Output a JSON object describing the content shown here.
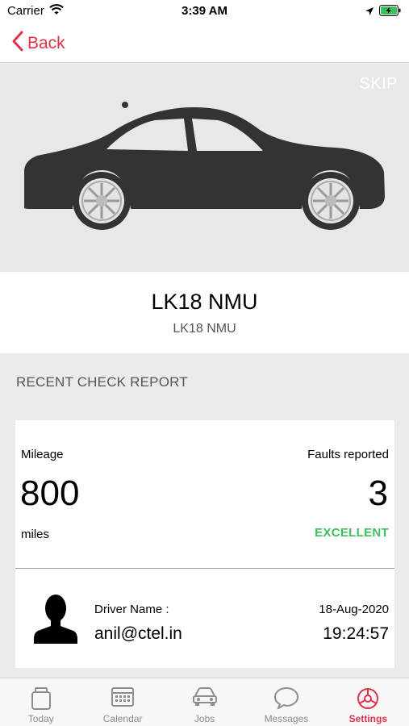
{
  "status_bar": {
    "carrier": "Carrier",
    "time": "3:39 AM"
  },
  "nav": {
    "back_label": "Back"
  },
  "hero": {
    "skip_label": "SKIP"
  },
  "vehicle": {
    "title": "LK18 NMU",
    "subtitle": "LK18 NMU"
  },
  "section": {
    "title": "RECENT CHECK REPORT"
  },
  "report": {
    "mileage_label": "Mileage",
    "mileage_value": "800",
    "mileage_unit": "miles",
    "faults_label": "Faults reported",
    "faults_value": "3",
    "rating": "EXCELLENT",
    "driver_label": "Driver Name :",
    "driver_value": "anil@ctel.in",
    "date": "18-Aug-2020",
    "time": "19:24:57"
  },
  "tabs": [
    {
      "label": "Today",
      "icon": "today-icon"
    },
    {
      "label": "Calendar",
      "icon": "calendar-icon"
    },
    {
      "label": "Jobs",
      "icon": "car-icon"
    },
    {
      "label": "Messages",
      "icon": "message-bubble-icon"
    },
    {
      "label": "Settings",
      "icon": "settings-gear-icon",
      "active": true
    }
  ],
  "colors": {
    "accent": "#e0324b",
    "rating": "#3cbf5c",
    "hero_bg": "#e8e8e8",
    "page_bg": "#ebebeb"
  }
}
